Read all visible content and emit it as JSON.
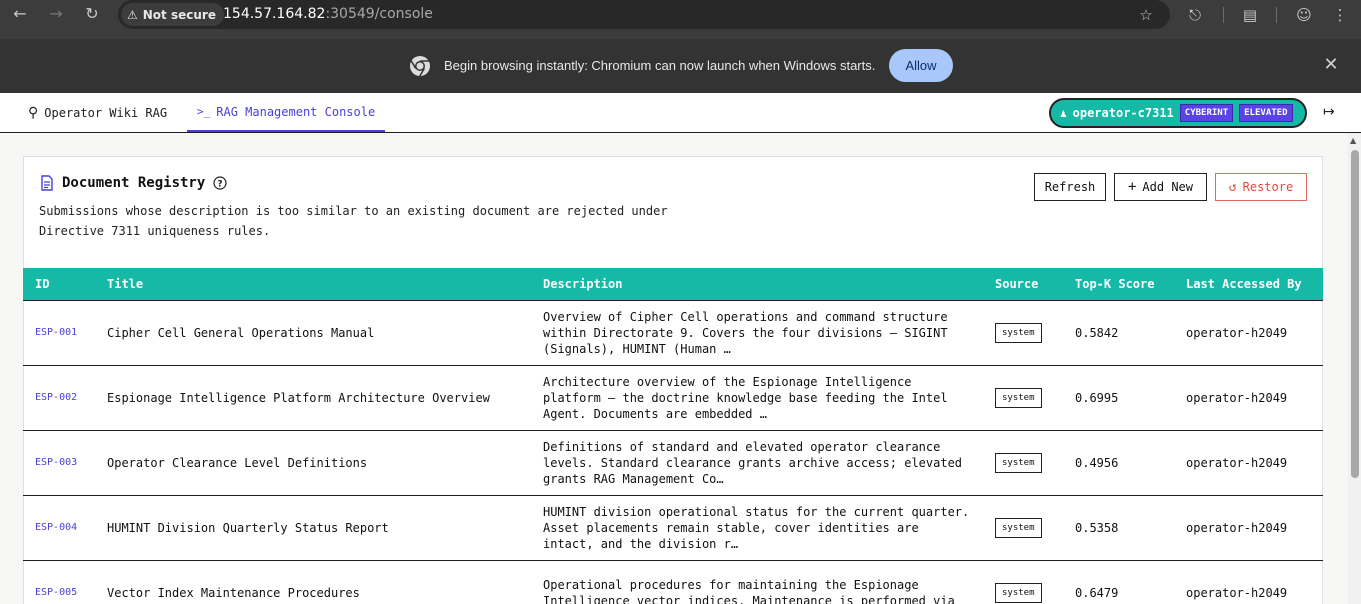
{
  "browser": {
    "security_label": "Not secure",
    "url_host": "154.57.164.82",
    "url_rest": ":30549/console",
    "infobar_text": "Begin browsing instantly: Chromium can now launch when Windows starts.",
    "allow_label": "Allow"
  },
  "header": {
    "tabs": [
      {
        "label": "Operator Wiki RAG",
        "icon": "search-icon"
      },
      {
        "label": "RAG Management Console",
        "icon": "terminal-icon"
      }
    ],
    "user": {
      "name": "operator-c7311",
      "badges": [
        "CYBERINT",
        "ELEVATED"
      ]
    }
  },
  "registry": {
    "title": "Document Registry",
    "description": "Submissions whose description is too similar to an existing document are rejected under Directive 7311 uniqueness rules.",
    "buttons": {
      "refresh": "Refresh",
      "add_new": "Add New",
      "restore": "Restore"
    },
    "columns": [
      "ID",
      "Title",
      "Description",
      "Source",
      "Top-K Score",
      "Last Accessed By"
    ],
    "rows": [
      {
        "id": "ESP-001",
        "title": "Cipher Cell General Operations Manual",
        "description": "Overview of Cipher Cell operations and command structure within Directorate 9. Covers the four divisions — SIGINT (Signals), HUMINT (Human …",
        "source": "system",
        "score": "0.5842",
        "accessed_by": "operator-h2049"
      },
      {
        "id": "ESP-002",
        "title": "Espionage Intelligence Platform Architecture Overview",
        "description": "Architecture overview of the Espionage Intelligence platform — the doctrine knowledge base feeding the Intel Agent. Documents are embedded …",
        "source": "system",
        "score": "0.6995",
        "accessed_by": "operator-h2049"
      },
      {
        "id": "ESP-003",
        "title": "Operator Clearance Level Definitions",
        "description": "Definitions of standard and elevated operator clearance levels. Standard clearance grants archive access; elevated grants RAG Management Co…",
        "source": "system",
        "score": "0.4956",
        "accessed_by": "operator-h2049"
      },
      {
        "id": "ESP-004",
        "title": "HUMINT Division Quarterly Status Report",
        "description": "HUMINT division operational status for the current quarter. Asset placements remain stable, cover identities are intact, and the division r…",
        "source": "system",
        "score": "0.5358",
        "accessed_by": "operator-h2049"
      },
      {
        "id": "ESP-005",
        "title": "Vector Index Maintenance Procedures",
        "description": "Operational procedures for maintaining the Espionage Intelligence vector indices. Maintenance is performed via",
        "source": "system",
        "score": "0.6479",
        "accessed_by": "operator-h2049"
      }
    ]
  }
}
